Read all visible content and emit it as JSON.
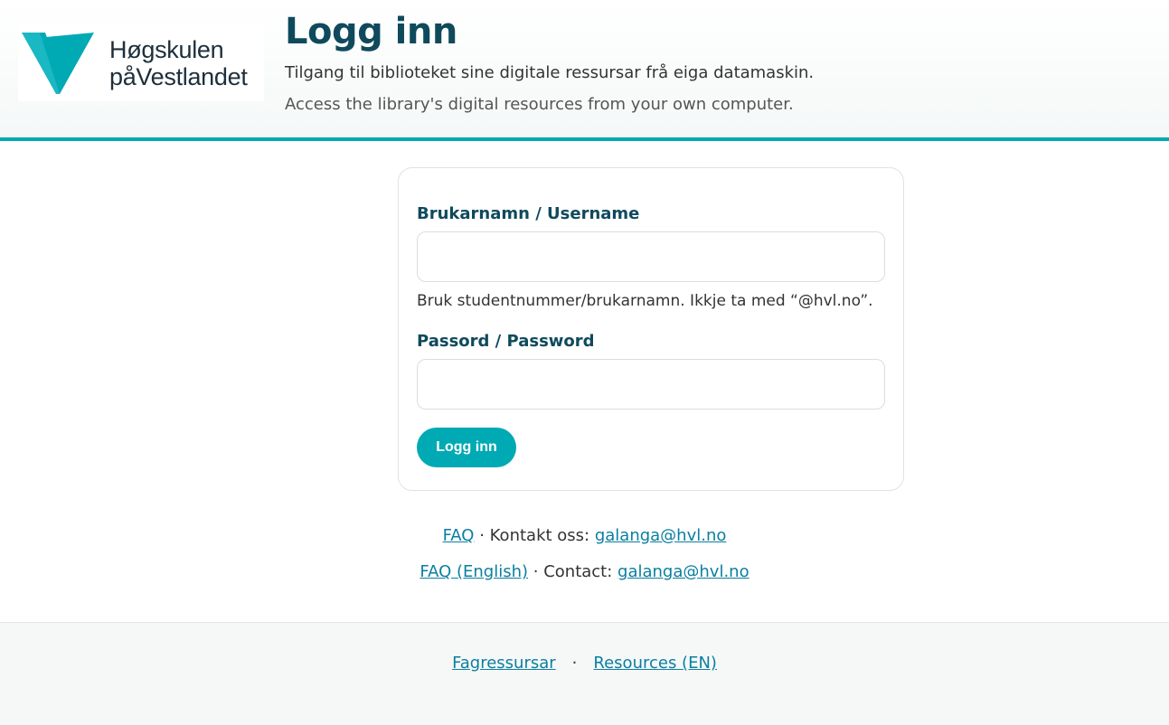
{
  "header": {
    "logo_line1": "Høgskulen",
    "logo_line2": "påVestlandet",
    "title": "Logg inn",
    "subtitle_no": "Tilgang til biblioteket sine digitale ressursar frå eiga datamaskin.",
    "subtitle_en": "Access the library's digital resources from your own computer."
  },
  "form": {
    "username_label": "Brukarnamn / Username",
    "username_value": "",
    "username_hint": "Bruk studentnummer/brukarnamn. Ikkje ta med “@hvl.no”.",
    "password_label": "Passord / Password",
    "password_value": "",
    "submit_label": "Logg inn"
  },
  "contact": {
    "faq_label": "FAQ",
    "contact_no_text": " · Kontakt oss: ",
    "email_no": "galanga@hvl.no",
    "faq_en_label": "FAQ (English)",
    "contact_en_text": " · Contact: ",
    "email_en": "galanga@hvl.no"
  },
  "footer": {
    "link1": "Fagressursar",
    "separator": "·",
    "link2": "Resources (EN)"
  },
  "colors": {
    "accent": "#00a9b4",
    "title": "#0f4a5c",
    "link": "#0a7fa0"
  },
  "icons": {
    "logo": "hvl-v-logo-icon"
  }
}
